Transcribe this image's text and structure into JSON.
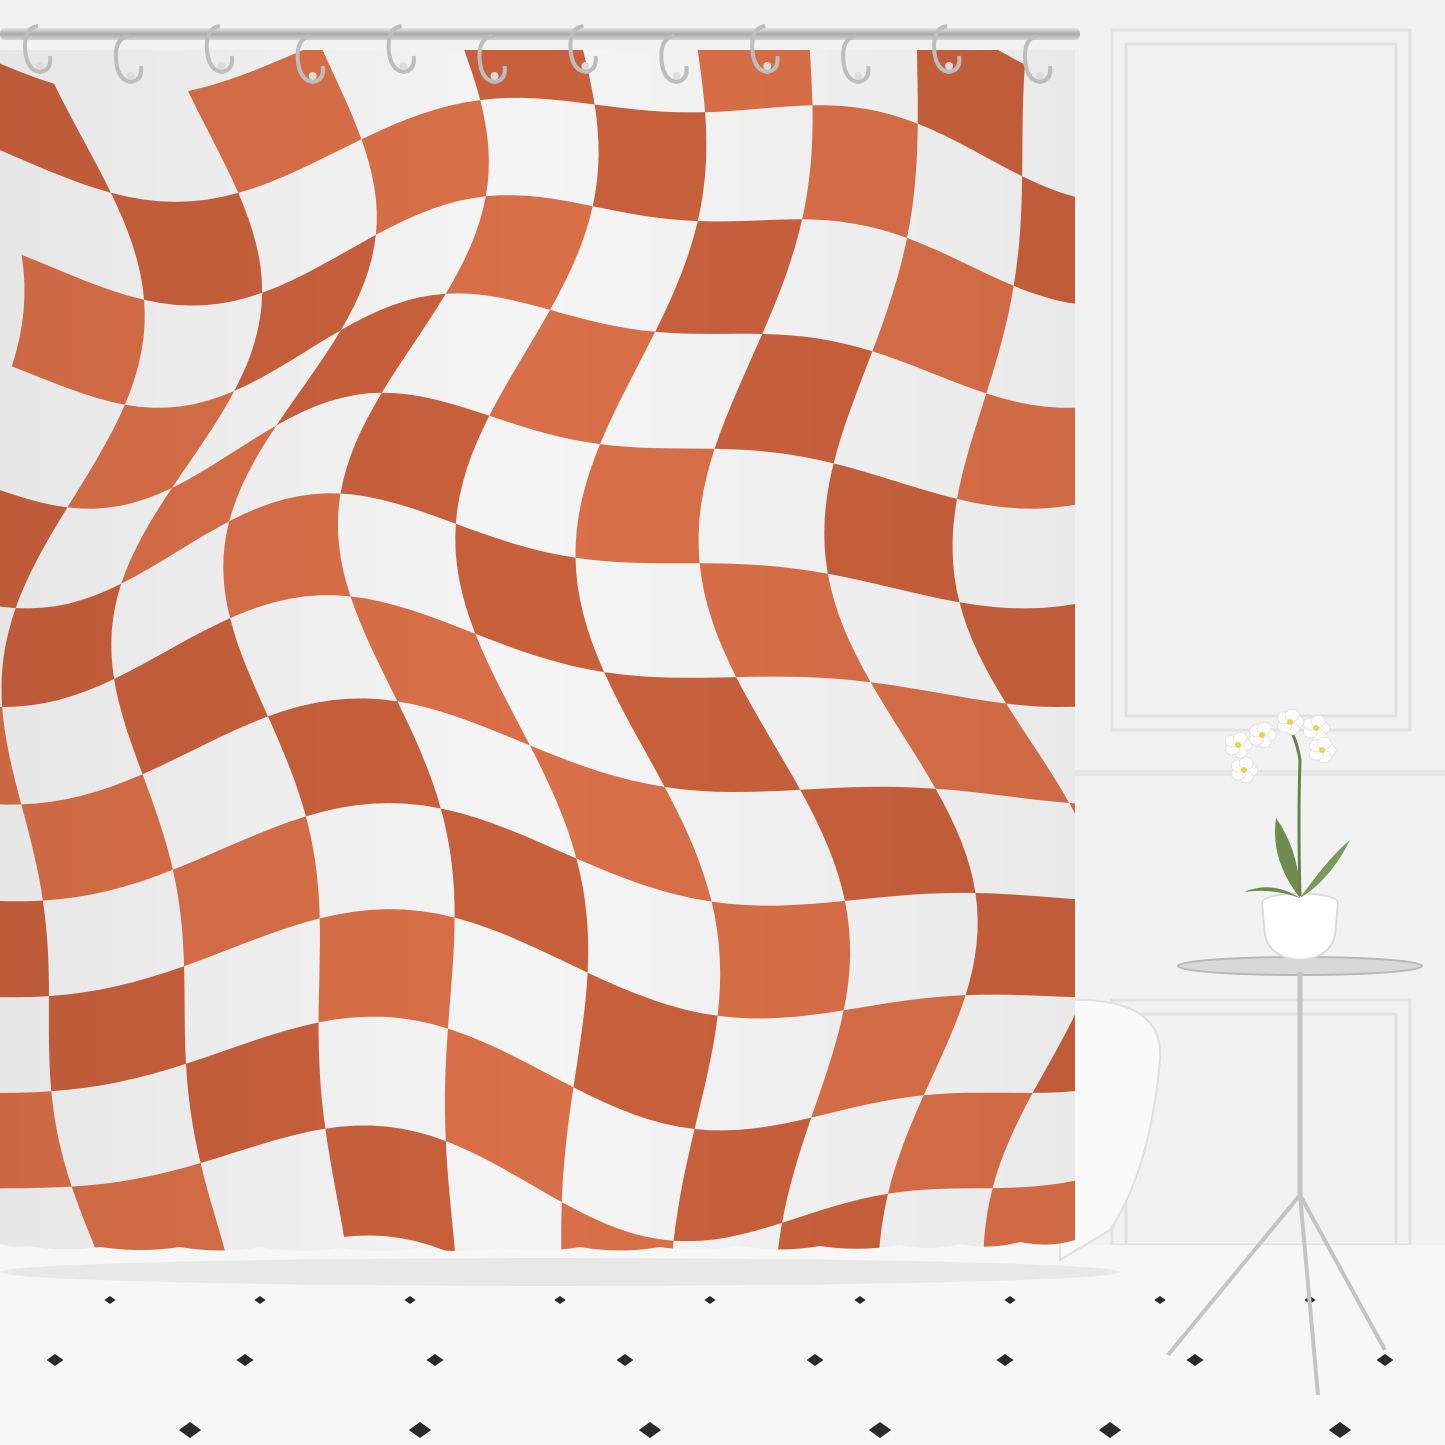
{
  "scene": {
    "subject": "shower-curtain",
    "pattern": "wavy-checkerboard",
    "colors": {
      "orange": "#d96f48",
      "orange_dark": "#c9603c",
      "white": "#f5f5f5",
      "wall": "#f2f2f2",
      "wall_trim": "#e4e4e4",
      "floor": "#f7f7f7",
      "floor_tile_mark": "#2a2a2a",
      "rod": "#c8c8c8",
      "ring": "#bdbdbd",
      "table_glass": "#d8d8d8",
      "pot": "#ffffff",
      "leaf": "#6f8b4f",
      "flower_center": "#e8d24a"
    },
    "ring_count": 12,
    "props": [
      "bathtub",
      "side-table",
      "orchid-plant"
    ]
  }
}
